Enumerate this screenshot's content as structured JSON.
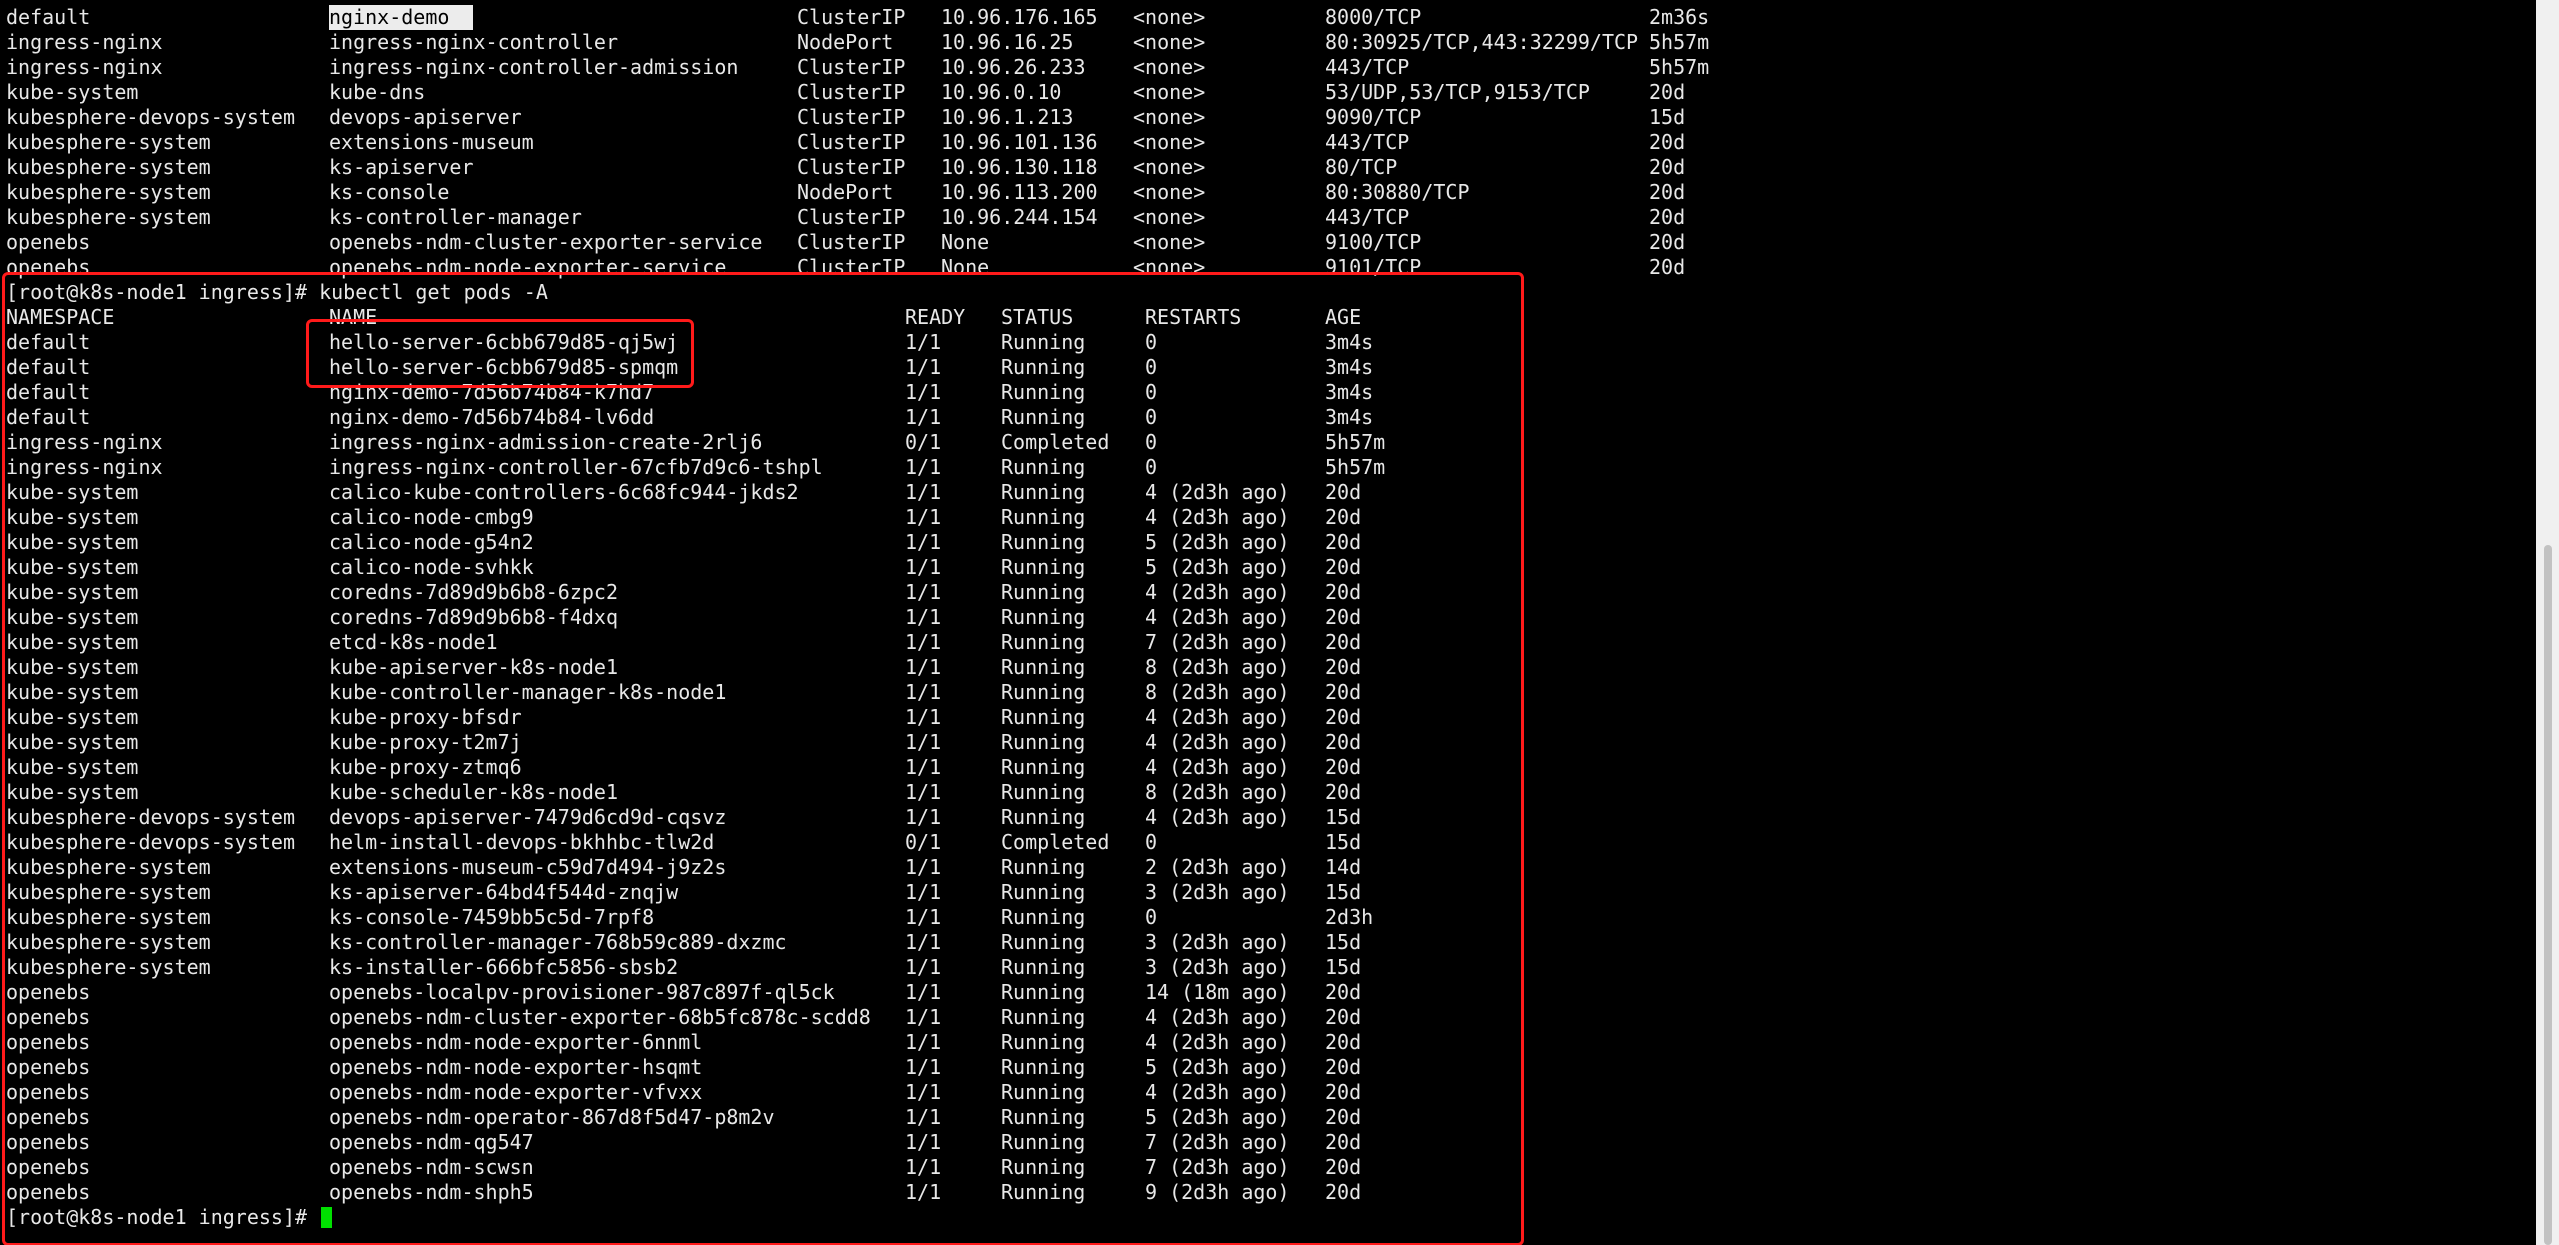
{
  "terminal": {
    "service_rows": [
      {
        "namespace": "default",
        "name": "nginx-demo",
        "type": "ClusterIP",
        "cluster_ip": "10.96.176.165",
        "external_ip": "<none>",
        "ports": "8000/TCP",
        "age": "2m36s"
      },
      {
        "namespace": "ingress-nginx",
        "name": "ingress-nginx-controller",
        "type": "NodePort",
        "cluster_ip": "10.96.16.25",
        "external_ip": "<none>",
        "ports": "80:30925/TCP,443:32299/TCP",
        "age": "5h57m"
      },
      {
        "namespace": "ingress-nginx",
        "name": "ingress-nginx-controller-admission",
        "type": "ClusterIP",
        "cluster_ip": "10.96.26.233",
        "external_ip": "<none>",
        "ports": "443/TCP",
        "age": "5h57m"
      },
      {
        "namespace": "kube-system",
        "name": "kube-dns",
        "type": "ClusterIP",
        "cluster_ip": "10.96.0.10",
        "external_ip": "<none>",
        "ports": "53/UDP,53/TCP,9153/TCP",
        "age": "20d"
      },
      {
        "namespace": "kubesphere-devops-system",
        "name": "devops-apiserver",
        "type": "ClusterIP",
        "cluster_ip": "10.96.1.213",
        "external_ip": "<none>",
        "ports": "9090/TCP",
        "age": "15d"
      },
      {
        "namespace": "kubesphere-system",
        "name": "extensions-museum",
        "type": "ClusterIP",
        "cluster_ip": "10.96.101.136",
        "external_ip": "<none>",
        "ports": "443/TCP",
        "age": "20d"
      },
      {
        "namespace": "kubesphere-system",
        "name": "ks-apiserver",
        "type": "ClusterIP",
        "cluster_ip": "10.96.130.118",
        "external_ip": "<none>",
        "ports": "80/TCP",
        "age": "20d"
      },
      {
        "namespace": "kubesphere-system",
        "name": "ks-console",
        "type": "NodePort",
        "cluster_ip": "10.96.113.200",
        "external_ip": "<none>",
        "ports": "80:30880/TCP",
        "age": "20d"
      },
      {
        "namespace": "kubesphere-system",
        "name": "ks-controller-manager",
        "type": "ClusterIP",
        "cluster_ip": "10.96.244.154",
        "external_ip": "<none>",
        "ports": "443/TCP",
        "age": "20d"
      },
      {
        "namespace": "openebs",
        "name": "openebs-ndm-cluster-exporter-service",
        "type": "ClusterIP",
        "cluster_ip": "None",
        "external_ip": "<none>",
        "ports": "9100/TCP",
        "age": "20d"
      },
      {
        "namespace": "openebs",
        "name": "openebs-ndm-node-exporter-service",
        "type": "ClusterIP",
        "cluster_ip": "None",
        "external_ip": "<none>",
        "ports": "9101/TCP",
        "age": "20d"
      }
    ],
    "prompt": "[root@k8s-node1 ingress]#",
    "command": "kubectl get pods -A",
    "pod_headers": {
      "namespace": "NAMESPACE",
      "name": "NAME",
      "ready": "READY",
      "status": "STATUS",
      "restarts": "RESTARTS",
      "age": "AGE"
    },
    "pod_rows": [
      {
        "namespace": "default",
        "name": "hello-server-6cbb679d85-qj5wj",
        "ready": "1/1",
        "status": "Running",
        "restarts": "0",
        "age": "3m4s"
      },
      {
        "namespace": "default",
        "name": "hello-server-6cbb679d85-spmqm",
        "ready": "1/1",
        "status": "Running",
        "restarts": "0",
        "age": "3m4s"
      },
      {
        "namespace": "default",
        "name": "nginx-demo-7d56b74b84-k7hd7",
        "ready": "1/1",
        "status": "Running",
        "restarts": "0",
        "age": "3m4s"
      },
      {
        "namespace": "default",
        "name": "nginx-demo-7d56b74b84-lv6dd",
        "ready": "1/1",
        "status": "Running",
        "restarts": "0",
        "age": "3m4s"
      },
      {
        "namespace": "ingress-nginx",
        "name": "ingress-nginx-admission-create-2rlj6",
        "ready": "0/1",
        "status": "Completed",
        "restarts": "0",
        "age": "5h57m"
      },
      {
        "namespace": "ingress-nginx",
        "name": "ingress-nginx-controller-67cfb7d9c6-tshpl",
        "ready": "1/1",
        "status": "Running",
        "restarts": "0",
        "age": "5h57m"
      },
      {
        "namespace": "kube-system",
        "name": "calico-kube-controllers-6c68fc944-jkds2",
        "ready": "1/1",
        "status": "Running",
        "restarts": "4 (2d3h ago)",
        "age": "20d"
      },
      {
        "namespace": "kube-system",
        "name": "calico-node-cmbg9",
        "ready": "1/1",
        "status": "Running",
        "restarts": "4 (2d3h ago)",
        "age": "20d"
      },
      {
        "namespace": "kube-system",
        "name": "calico-node-g54n2",
        "ready": "1/1",
        "status": "Running",
        "restarts": "5 (2d3h ago)",
        "age": "20d"
      },
      {
        "namespace": "kube-system",
        "name": "calico-node-svhkk",
        "ready": "1/1",
        "status": "Running",
        "restarts": "5 (2d3h ago)",
        "age": "20d"
      },
      {
        "namespace": "kube-system",
        "name": "coredns-7d89d9b6b8-6zpc2",
        "ready": "1/1",
        "status": "Running",
        "restarts": "4 (2d3h ago)",
        "age": "20d"
      },
      {
        "namespace": "kube-system",
        "name": "coredns-7d89d9b6b8-f4dxq",
        "ready": "1/1",
        "status": "Running",
        "restarts": "4 (2d3h ago)",
        "age": "20d"
      },
      {
        "namespace": "kube-system",
        "name": "etcd-k8s-node1",
        "ready": "1/1",
        "status": "Running",
        "restarts": "7 (2d3h ago)",
        "age": "20d"
      },
      {
        "namespace": "kube-system",
        "name": "kube-apiserver-k8s-node1",
        "ready": "1/1",
        "status": "Running",
        "restarts": "8 (2d3h ago)",
        "age": "20d"
      },
      {
        "namespace": "kube-system",
        "name": "kube-controller-manager-k8s-node1",
        "ready": "1/1",
        "status": "Running",
        "restarts": "8 (2d3h ago)",
        "age": "20d"
      },
      {
        "namespace": "kube-system",
        "name": "kube-proxy-bfsdr",
        "ready": "1/1",
        "status": "Running",
        "restarts": "4 (2d3h ago)",
        "age": "20d"
      },
      {
        "namespace": "kube-system",
        "name": "kube-proxy-t2m7j",
        "ready": "1/1",
        "status": "Running",
        "restarts": "4 (2d3h ago)",
        "age": "20d"
      },
      {
        "namespace": "kube-system",
        "name": "kube-proxy-ztmq6",
        "ready": "1/1",
        "status": "Running",
        "restarts": "4 (2d3h ago)",
        "age": "20d"
      },
      {
        "namespace": "kube-system",
        "name": "kube-scheduler-k8s-node1",
        "ready": "1/1",
        "status": "Running",
        "restarts": "8 (2d3h ago)",
        "age": "20d"
      },
      {
        "namespace": "kubesphere-devops-system",
        "name": "devops-apiserver-7479d6cd9d-cqsvz",
        "ready": "1/1",
        "status": "Running",
        "restarts": "4 (2d3h ago)",
        "age": "15d"
      },
      {
        "namespace": "kubesphere-devops-system",
        "name": "helm-install-devops-bkhhbc-tlw2d",
        "ready": "0/1",
        "status": "Completed",
        "restarts": "0",
        "age": "15d"
      },
      {
        "namespace": "kubesphere-system",
        "name": "extensions-museum-c59d7d494-j9z2s",
        "ready": "1/1",
        "status": "Running",
        "restarts": "2 (2d3h ago)",
        "age": "14d"
      },
      {
        "namespace": "kubesphere-system",
        "name": "ks-apiserver-64bd4f544d-znqjw",
        "ready": "1/1",
        "status": "Running",
        "restarts": "3 (2d3h ago)",
        "age": "15d"
      },
      {
        "namespace": "kubesphere-system",
        "name": "ks-console-7459bb5c5d-7rpf8",
        "ready": "1/1",
        "status": "Running",
        "restarts": "0",
        "age": "2d3h"
      },
      {
        "namespace": "kubesphere-system",
        "name": "ks-controller-manager-768b59c889-dxzmc",
        "ready": "1/1",
        "status": "Running",
        "restarts": "3 (2d3h ago)",
        "age": "15d"
      },
      {
        "namespace": "kubesphere-system",
        "name": "ks-installer-666bfc5856-sbsb2",
        "ready": "1/1",
        "status": "Running",
        "restarts": "3 (2d3h ago)",
        "age": "15d"
      },
      {
        "namespace": "openebs",
        "name": "openebs-localpv-provisioner-987c897f-ql5ck",
        "ready": "1/1",
        "status": "Running",
        "restarts": "14 (18m ago)",
        "age": "20d"
      },
      {
        "namespace": "openebs",
        "name": "openebs-ndm-cluster-exporter-68b5fc878c-scdd8",
        "ready": "1/1",
        "status": "Running",
        "restarts": "4 (2d3h ago)",
        "age": "20d"
      },
      {
        "namespace": "openebs",
        "name": "openebs-ndm-node-exporter-6nnml",
        "ready": "1/1",
        "status": "Running",
        "restarts": "4 (2d3h ago)",
        "age": "20d"
      },
      {
        "namespace": "openebs",
        "name": "openebs-ndm-node-exporter-hsqmt",
        "ready": "1/1",
        "status": "Running",
        "restarts": "5 (2d3h ago)",
        "age": "20d"
      },
      {
        "namespace": "openebs",
        "name": "openebs-ndm-node-exporter-vfvxx",
        "ready": "1/1",
        "status": "Running",
        "restarts": "4 (2d3h ago)",
        "age": "20d"
      },
      {
        "namespace": "openebs",
        "name": "openebs-ndm-operator-867d8f5d47-p8m2v",
        "ready": "1/1",
        "status": "Running",
        "restarts": "5 (2d3h ago)",
        "age": "20d"
      },
      {
        "namespace": "openebs",
        "name": "openebs-ndm-qg547",
        "ready": "1/1",
        "status": "Running",
        "restarts": "7 (2d3h ago)",
        "age": "20d"
      },
      {
        "namespace": "openebs",
        "name": "openebs-ndm-scwsn",
        "ready": "1/1",
        "status": "Running",
        "restarts": "7 (2d3h ago)",
        "age": "20d"
      },
      {
        "namespace": "openebs",
        "name": "openebs-ndm-shph5",
        "ready": "1/1",
        "status": "Running",
        "restarts": "9 (2d3h ago)",
        "age": "20d"
      }
    ]
  },
  "colors": {
    "background": "#000000",
    "text": "#e8e8e8",
    "highlight_box": "#ff1a1a",
    "cursor": "#00e000",
    "selection": "#ececec"
  }
}
